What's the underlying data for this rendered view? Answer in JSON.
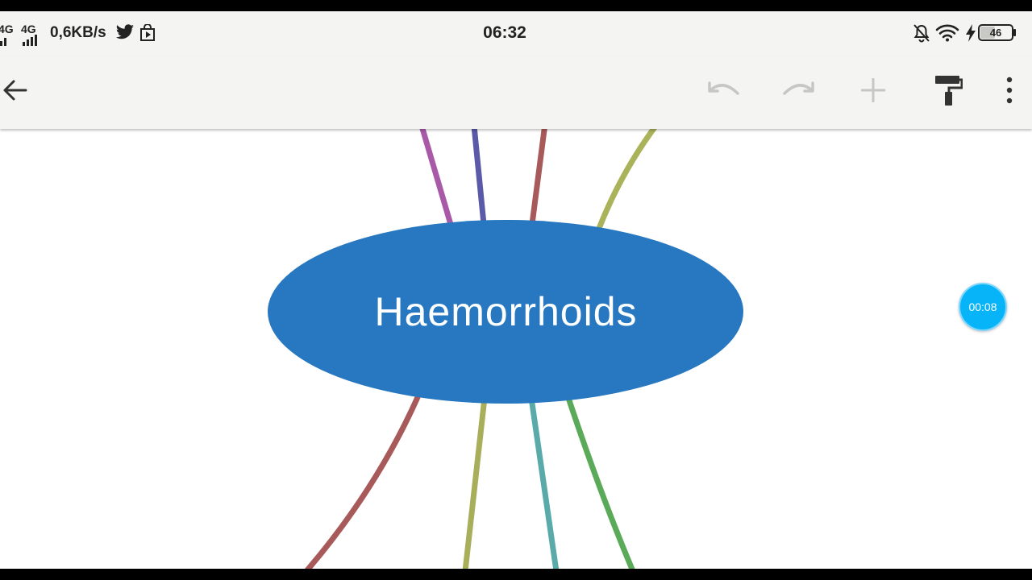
{
  "status_bar": {
    "network_primary": "4G",
    "network_secondary": "4G",
    "data_speed": "0,6KB/s",
    "time": "06:32",
    "battery_level": "46",
    "icons": [
      "signal-icon",
      "twitter-icon",
      "play-store-icon",
      "notifications-off-icon",
      "wifi-icon",
      "charging-icon",
      "battery-icon"
    ]
  },
  "toolbar": {
    "back_icon": "arrow-left-icon",
    "undo_icon": "undo-icon",
    "redo_icon": "redo-icon",
    "add_icon": "plus-icon",
    "format_icon": "paint-roller-icon",
    "more_icon": "more-vertical-icon",
    "undo_enabled": false,
    "redo_enabled": false,
    "add_enabled": false
  },
  "mindmap": {
    "central_topic": "Haemorrhoids",
    "central_color": "#2778c0",
    "branch_colors": [
      "#a85aa8",
      "#5a5aa8",
      "#a85a5a",
      "#aab25a",
      "#a85a5a",
      "#a8ae5a",
      "#5aaaaa",
      "#5aaa5a"
    ]
  },
  "recording_timer": "00:08"
}
